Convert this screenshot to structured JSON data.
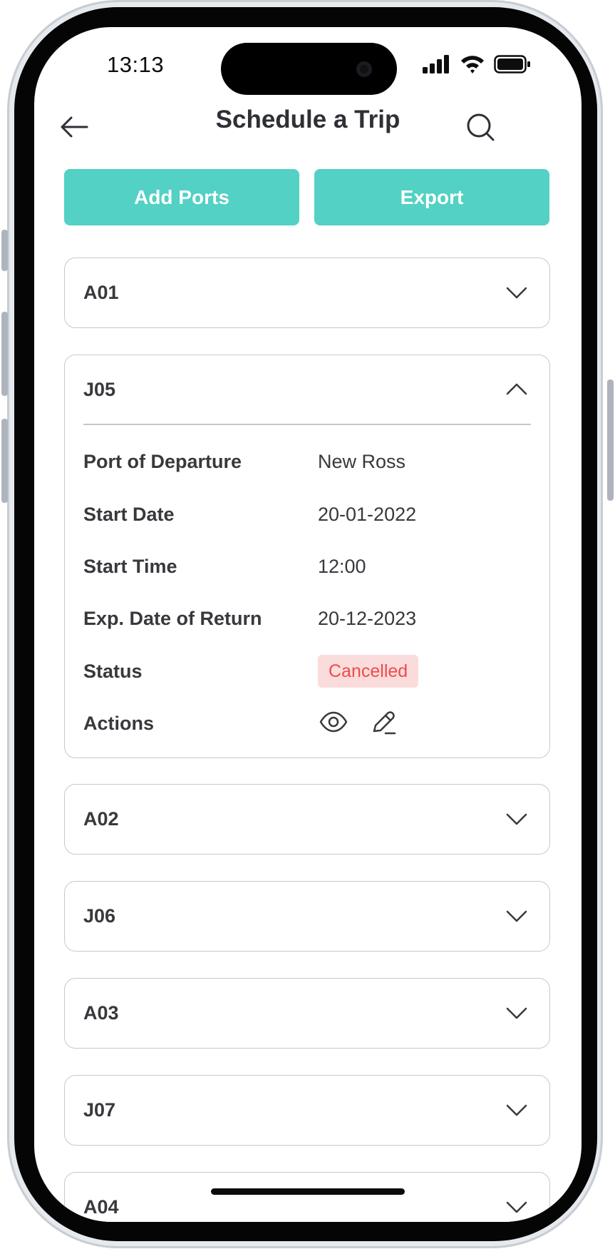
{
  "status_bar": {
    "time": "13:13",
    "signal_icon": "cellular-signal-icon",
    "wifi_icon": "wifi-icon",
    "battery_icon": "battery-icon"
  },
  "header": {
    "title": "Schedule a Trip",
    "back_icon": "arrow-left-icon",
    "search_icon": "search-icon"
  },
  "toolbar": {
    "add_ports_label": "Add Ports",
    "export_label": "Export",
    "accent_color": "#52d1c4"
  },
  "trips": [
    {
      "id": "A01",
      "expanded": false
    },
    {
      "id": "J05",
      "expanded": true,
      "details": {
        "port_of_departure_label": "Port of Departure",
        "port_of_departure": "New Ross",
        "start_date_label": "Start Date",
        "start_date": "20-01-2022",
        "start_time_label": "Start Time",
        "start_time": "12:00",
        "return_date_label": "Exp. Date of Return",
        "return_date": "20-12-2023",
        "status_label": "Status",
        "status": "Cancelled",
        "status_color": "#ee4b4b",
        "actions_label": "Actions",
        "actions": [
          "eye-icon",
          "pencil-icon"
        ]
      }
    },
    {
      "id": "A02",
      "expanded": false
    },
    {
      "id": "J06",
      "expanded": false
    },
    {
      "id": "A03",
      "expanded": false
    },
    {
      "id": "J07",
      "expanded": false
    },
    {
      "id": "A04",
      "expanded": false
    }
  ]
}
